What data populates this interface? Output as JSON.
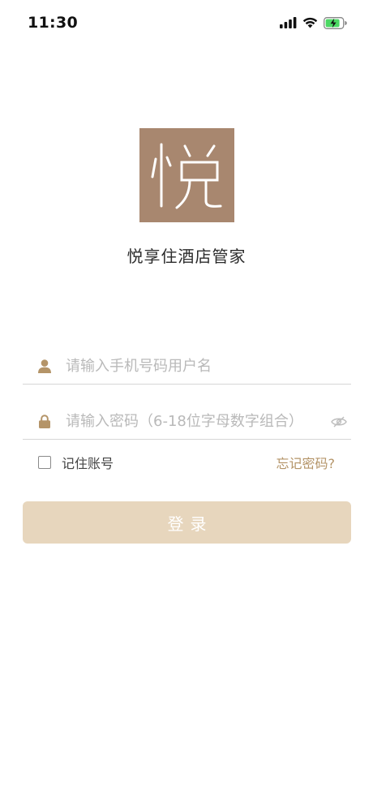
{
  "status_bar": {
    "time": "11:30",
    "icons": [
      "cellular-signal-icon",
      "wifi-icon",
      "battery-charging-icon"
    ]
  },
  "logo": {
    "glyph": "悦",
    "background_color": "#a8876f"
  },
  "app": {
    "name": "悦享住酒店管家"
  },
  "form": {
    "phone": {
      "icon": "user-icon",
      "placeholder": "请输入手机号码用户名",
      "value": ""
    },
    "password": {
      "icon": "lock-icon",
      "placeholder": "请输入密码（6-18位字母数字组合）",
      "value": "",
      "toggle_icon": "eye-off-icon"
    },
    "remember": {
      "label": "记住账号",
      "checked": false
    },
    "forgot_label": "忘记密码?",
    "login_label": "登录"
  },
  "colors": {
    "accent": "#b49468",
    "button_bg": "#e7d6bd",
    "logo_bg": "#a8876f"
  }
}
